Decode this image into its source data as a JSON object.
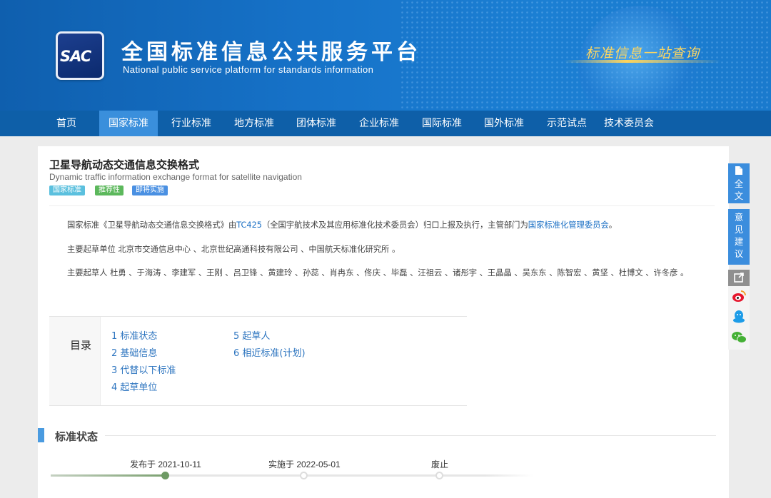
{
  "header": {
    "logo_text": "SAC",
    "title": "全国标准信息公共服务平台",
    "subtitle": "National public service platform  for standards information",
    "slogan": "标准信息一站查询"
  },
  "nav": {
    "items": [
      "首页",
      "国家标准",
      "行业标准",
      "地方标准",
      "团体标准",
      "企业标准",
      "国际标准",
      "国外标准",
      "示范试点",
      "技术委员会"
    ],
    "active_index": 1
  },
  "standard": {
    "title_cn": "卫星导航动态交通信息交换格式",
    "title_en": "Dynamic traffic information exchange format for satellite navigation",
    "tags": [
      {
        "label": "国家标准",
        "color": "#5bc0de"
      },
      {
        "label": "推荐性",
        "color": "#5cb85c"
      },
      {
        "label": "即将实施",
        "color": "#4a90e2"
      }
    ]
  },
  "paragraphs": {
    "p1_before": "国家标准《卫星导航动态交通信息交换格式》由",
    "p1_link1": "TC425",
    "p1_middle": "（全国宇航技术及其应用标准化技术委员会）归口上报及执行，主管部门为",
    "p1_link2": "国家标准化管理委员会",
    "p1_end": "。",
    "p2": "主要起草单位 北京市交通信息中心 、北京世纪高通科技有限公司 、中国航天标准化研究所 。",
    "p3": "主要起草人 杜勇 、于海涛 、李建军 、王刚 、吕卫锋 、黄建玲 、孙蕊 、肖冉东 、佟庆 、毕磊 、汪祖云 、诸彤宇 、王晶晶 、吴东东 、陈智宏 、黄坚 、杜博文 、许冬彦 。"
  },
  "toc": {
    "label": "目录",
    "items": [
      "1  标准状态",
      "2  基础信息",
      "3  代替以下标准",
      "4  起草单位",
      "5  起草人",
      "6  相近标准(计划)"
    ]
  },
  "status_section": {
    "title": "标准状态",
    "timeline": [
      {
        "label": "发布于 2021-10-11",
        "reached": true
      },
      {
        "label": "实施于 2022-05-01",
        "reached": false
      },
      {
        "label": "废止",
        "reached": false
      }
    ]
  },
  "sidebar": {
    "fulltext": "全文",
    "feedback": "意见建议"
  },
  "colors": {
    "nav_bg": "#0e5fa8",
    "nav_active": "#3a8fdc",
    "link": "#1a6fc4",
    "accent": "#4a9be0"
  }
}
